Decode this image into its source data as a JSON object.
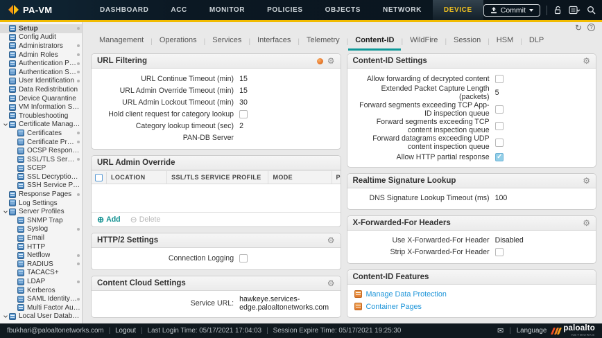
{
  "colors": {
    "accent_yellow": "#f1bb00",
    "accent_teal": "#0e9898",
    "link_blue": "#1e95d9",
    "checked_blue": "#93cfe8",
    "nav_active_text": "#f2c220"
  },
  "top_nav": {
    "brand": "PA-VM",
    "tabs": [
      {
        "label": "DASHBOARD",
        "active": false
      },
      {
        "label": "ACC",
        "active": false
      },
      {
        "label": "MONITOR",
        "active": false
      },
      {
        "label": "POLICIES",
        "active": false
      },
      {
        "label": "OBJECTS",
        "active": false
      },
      {
        "label": "NETWORK",
        "active": false
      },
      {
        "label": "DEVICE",
        "active": true
      }
    ],
    "commit_label": "Commit",
    "icons": [
      "lock-icon",
      "config-tasks-icon",
      "search-icon"
    ]
  },
  "util_strip": {
    "icons": [
      "refresh-icon",
      "help-icon"
    ],
    "help_glyph": "?",
    "refresh_glyph": "↻"
  },
  "sidebar": {
    "items": [
      {
        "label": "Setup",
        "level": 0,
        "selected": true,
        "marker": true
      },
      {
        "label": "Config Audit",
        "level": 0
      },
      {
        "label": "Administrators",
        "level": 0,
        "marker": true
      },
      {
        "label": "Admin Roles",
        "level": 0,
        "marker": true
      },
      {
        "label": "Authentication Profile",
        "level": 0,
        "marker": true
      },
      {
        "label": "Authentication Sequence",
        "level": 0,
        "marker": true
      },
      {
        "label": "User Identification",
        "level": 0,
        "marker": true
      },
      {
        "label": "Data Redistribution",
        "level": 0
      },
      {
        "label": "Device Quarantine",
        "level": 0
      },
      {
        "label": "VM Information Sources",
        "level": 0
      },
      {
        "label": "Troubleshooting",
        "level": 0
      },
      {
        "label": "Certificate Management",
        "level": 0,
        "expanded": true
      },
      {
        "label": "Certificates",
        "level": 1,
        "marker": true
      },
      {
        "label": "Certificate Profile",
        "level": 1,
        "marker": true
      },
      {
        "label": "OCSP Responder",
        "level": 1
      },
      {
        "label": "SSL/TLS Service Profile",
        "level": 1,
        "marker": true
      },
      {
        "label": "SCEP",
        "level": 1
      },
      {
        "label": "SSL Decryption Exclusion",
        "level": 1
      },
      {
        "label": "SSH Service Profile",
        "level": 1
      },
      {
        "label": "Response Pages",
        "level": 0,
        "marker": true
      },
      {
        "label": "Log Settings",
        "level": 0
      },
      {
        "label": "Server Profiles",
        "level": 0,
        "expanded": true
      },
      {
        "label": "SNMP Trap",
        "level": 1
      },
      {
        "label": "Syslog",
        "level": 1,
        "marker": true
      },
      {
        "label": "Email",
        "level": 1
      },
      {
        "label": "HTTP",
        "level": 1
      },
      {
        "label": "Netflow",
        "level": 1,
        "marker": true
      },
      {
        "label": "RADIUS",
        "level": 1,
        "marker": true
      },
      {
        "label": "TACACS+",
        "level": 1
      },
      {
        "label": "LDAP",
        "level": 1,
        "marker": true
      },
      {
        "label": "Kerberos",
        "level": 1
      },
      {
        "label": "SAML Identity Provider",
        "level": 1,
        "marker": true
      },
      {
        "label": "Multi Factor Authentication",
        "level": 1
      },
      {
        "label": "Local User Database",
        "level": 0,
        "expanded": true
      }
    ]
  },
  "content_tabs": [
    {
      "label": "Management",
      "active": false
    },
    {
      "label": "Operations",
      "active": false
    },
    {
      "label": "Services",
      "active": false
    },
    {
      "label": "Interfaces",
      "active": false
    },
    {
      "label": "Telemetry",
      "active": false
    },
    {
      "label": "Content-ID",
      "active": true
    },
    {
      "label": "WildFire",
      "active": false
    },
    {
      "label": "Session",
      "active": false
    },
    {
      "label": "HSM",
      "active": false
    },
    {
      "label": "DLP",
      "active": false
    }
  ],
  "panels": {
    "url_filtering": {
      "title": "URL Filtering",
      "header_icons": [
        "pan-db-status-icon",
        "gear-icon"
      ],
      "rows": [
        {
          "label": "URL Continue Timeout (min)",
          "value": "15"
        },
        {
          "label": "URL Admin Override Timeout (min)",
          "value": "15"
        },
        {
          "label": "URL Admin Lockout Timeout (min)",
          "value": "30"
        },
        {
          "label": "Hold client request for category lookup",
          "checkbox": false
        },
        {
          "label": "Category lookup timeout (sec)",
          "value": "2"
        },
        {
          "label": "PAN-DB Server",
          "value": ""
        }
      ]
    },
    "url_admin_override": {
      "title": "URL Admin Override",
      "columns": [
        "LOCATION",
        "SSL/TLS SERVICE PROFILE",
        "MODE",
        "PROPERTIES"
      ],
      "rows": [],
      "add_label": "Add",
      "delete_label": "Delete",
      "add_glyph": "⊕",
      "delete_glyph": "⊖"
    },
    "http2_settings": {
      "title": "HTTP/2 Settings",
      "header_icons": [
        "gear-icon"
      ],
      "rows": [
        {
          "label": "Connection Logging",
          "checkbox": false
        }
      ]
    },
    "content_cloud_settings": {
      "title": "Content Cloud Settings",
      "header_icons": [
        "gear-icon"
      ],
      "rows": [
        {
          "label": "Service URL:",
          "value": "hawkeye.services-edge.paloaltonetworks.com"
        }
      ]
    },
    "content_id_settings": {
      "title": "Content-ID Settings",
      "header_icons": [
        "gear-icon"
      ],
      "rows": [
        {
          "label": "Allow forwarding of decrypted content",
          "checkbox": false
        },
        {
          "label": "Extended Packet Capture Length (packets)",
          "value": "5"
        },
        {
          "label": "Forward segments exceeding TCP App-ID inspection queue",
          "checkbox": false
        },
        {
          "label": "Forward segments exceeding TCP content inspection queue",
          "checkbox": false
        },
        {
          "label": "Forward datagrams exceeding UDP content inspection queue",
          "checkbox": false
        },
        {
          "label": "Allow HTTP partial response",
          "checkbox": true
        }
      ]
    },
    "realtime_signature_lookup": {
      "title": "Realtime Signature Lookup",
      "header_icons": [
        "gear-icon"
      ],
      "rows": [
        {
          "label": "DNS Signature Lookup Timeout (ms)",
          "value": "100"
        }
      ]
    },
    "x_forwarded_for": {
      "title": "X-Forwarded-For Headers",
      "header_icons": [
        "gear-icon"
      ],
      "rows": [
        {
          "label": "Use X-Forwarded-For Header",
          "value": "Disabled"
        },
        {
          "label": "Strip X-Forwarded-For Header",
          "checkbox": false
        }
      ]
    },
    "content_id_features": {
      "title": "Content-ID Features",
      "links": [
        "Manage Data Protection",
        "Container Pages"
      ]
    }
  },
  "status_bar": {
    "user": "fbukhari@paloaltonetworks.com",
    "logout": "Logout",
    "last_login": "Last Login Time: 05/17/2021 17:04:03",
    "session_expire": "Session Expire Time: 05/17/2021 19:25:30",
    "mail_glyph": "✉",
    "language": "Language",
    "brand": "paloalto",
    "brand_sub": "NETWORKS"
  }
}
